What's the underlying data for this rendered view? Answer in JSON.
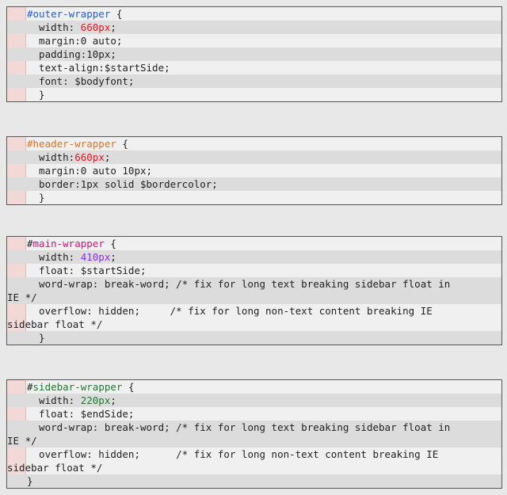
{
  "blocks": [
    {
      "selector_hash": "",
      "selector_name": "#outer-wrapper",
      "lines": [
        {
          "prop": "  width: ",
          "value": "660px",
          "tail": ";"
        },
        {
          "prop": "  margin:0 auto;",
          "value": "",
          "tail": ""
        },
        {
          "prop": "  padding:10px;",
          "value": "",
          "tail": ""
        },
        {
          "prop": "  text-align:$startSide;",
          "value": "",
          "tail": ""
        },
        {
          "prop": "  font: $bodyfont;",
          "value": "",
          "tail": ""
        },
        {
          "prop": "  }",
          "value": "",
          "tail": ""
        }
      ]
    },
    {
      "selector_hash": "",
      "selector_name": "#header-wrapper",
      "lines": [
        {
          "prop": "  width:",
          "value": "660px",
          "tail": ";"
        },
        {
          "prop": "  margin:0 auto 10px;",
          "value": "",
          "tail": ""
        },
        {
          "prop": "  border:1px solid $bordercolor;",
          "value": "",
          "tail": ""
        },
        {
          "prop": "  }",
          "value": "",
          "tail": ""
        }
      ]
    },
    {
      "selector_hash": "#",
      "selector_name": "main-wrapper",
      "lines": [
        {
          "prop": "  width: ",
          "value": "410px",
          "tail": ";"
        },
        {
          "prop": "  float: $startSide;",
          "value": "",
          "tail": ""
        },
        {
          "first": "  word-wrap: break-word; /* fix for long text breaking sidebar float in",
          "cont": "IE */"
        },
        {
          "first": "  overflow: hidden;     /* fix for long non-text content breaking IE",
          "cont": "sidebar float */"
        },
        {
          "prop": "  }",
          "value": "",
          "tail": ""
        }
      ]
    },
    {
      "selector_hash": "#",
      "selector_name": "sidebar-wrapper",
      "lines": [
        {
          "prop": "  width: ",
          "value": "220px",
          "tail": ";"
        },
        {
          "prop": "  float: $endSide;",
          "value": "",
          "tail": ""
        },
        {
          "first": "  word-wrap: break-word; /* fix for long text breaking sidebar float in",
          "cont": "IE */"
        },
        {
          "first": "  overflow: hidden;      /* fix for long non-text content breaking IE",
          "cont": "sidebar float */"
        },
        {
          "prop": "}",
          "value": "",
          "tail": ""
        }
      ]
    }
  ],
  "brace_open": " {"
}
